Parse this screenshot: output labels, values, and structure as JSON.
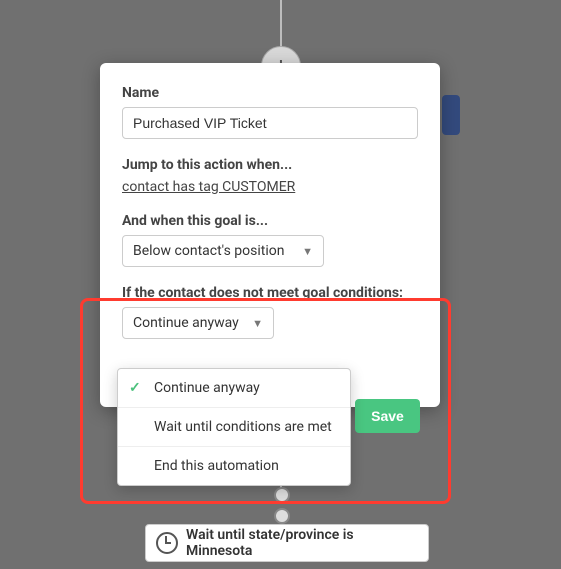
{
  "modal": {
    "name_label": "Name",
    "name_value": "Purchased VIP Ticket",
    "jump_label": "Jump to this action when...",
    "jump_link": "contact has tag CUSTOMER",
    "goal_label": "And when this goal is...",
    "goal_select": "Below contact's position",
    "fallback_label": "If the contact does not meet goal conditions:",
    "fallback_select": "Continue anyway",
    "save_label": "Save",
    "options": {
      "0": "Continue anyway",
      "1": "Wait until conditions are met",
      "2": "End this automation"
    }
  },
  "flow": {
    "plus": "+",
    "wait_step": "Wait until state/province is Minnesota"
  },
  "icons": {
    "caret": "▼",
    "check": "✓"
  }
}
